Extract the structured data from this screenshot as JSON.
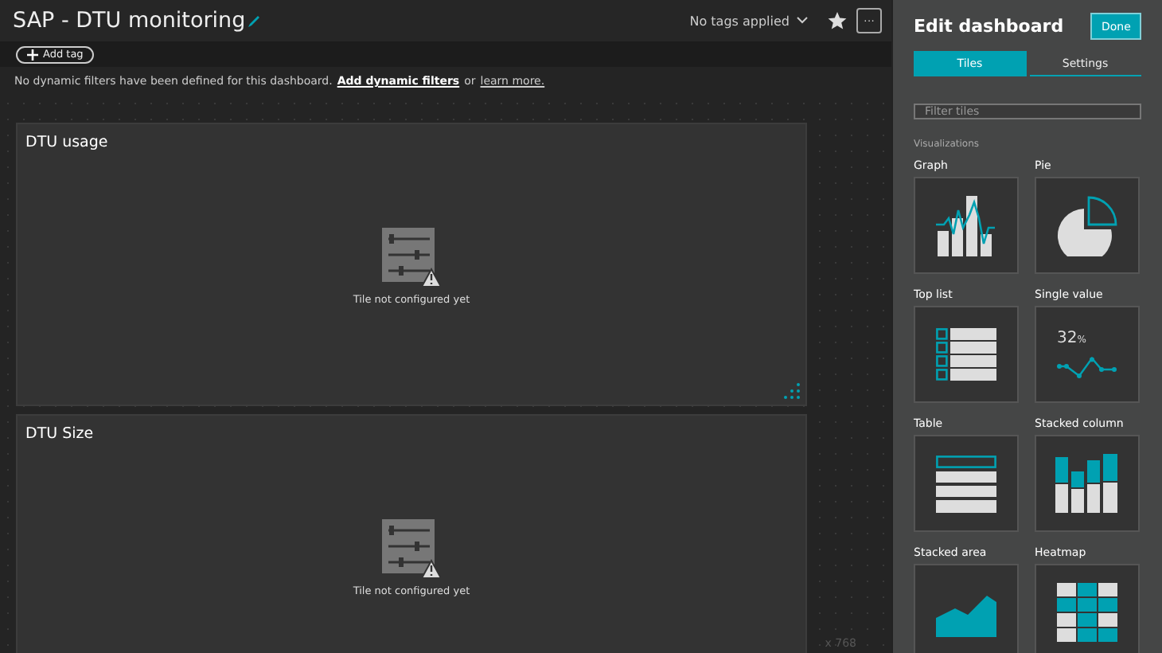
{
  "header": {
    "title": "SAP - DTU monitoring",
    "tags_label": "No tags applied",
    "more_button": "···"
  },
  "tag_bar": {
    "add_tag": "Add tag"
  },
  "filter_notice": {
    "text": "No dynamic filters have been defined for this dashboard.",
    "link": "Add dynamic filters",
    "joiner": "or",
    "learn_more": "learn more."
  },
  "tiles": [
    {
      "title": "DTU usage",
      "message": "Tile not configured yet"
    },
    {
      "title": "DTU Size",
      "message": "Tile not configured yet"
    }
  ],
  "canvas_size": "x  768",
  "panel": {
    "title": "Edit dashboard",
    "done": "Done",
    "tabs": [
      {
        "label": "Tiles",
        "selected": true
      },
      {
        "label": "Settings",
        "selected": false
      }
    ],
    "search": {
      "placeholder": "Filter tiles"
    },
    "section": "Visualizations",
    "visualizations": [
      {
        "label": "Graph",
        "kind": "graph"
      },
      {
        "label": "Pie",
        "kind": "pie"
      },
      {
        "label": "Top list",
        "kind": "toplist"
      },
      {
        "label": "Single value",
        "kind": "single",
        "value": "32",
        "unit": "%"
      },
      {
        "label": "Table",
        "kind": "table"
      },
      {
        "label": "Stacked column",
        "kind": "stacked"
      },
      {
        "label": "Stacked area",
        "kind": "area"
      },
      {
        "label": "Heatmap",
        "kind": "heatmap"
      }
    ]
  }
}
